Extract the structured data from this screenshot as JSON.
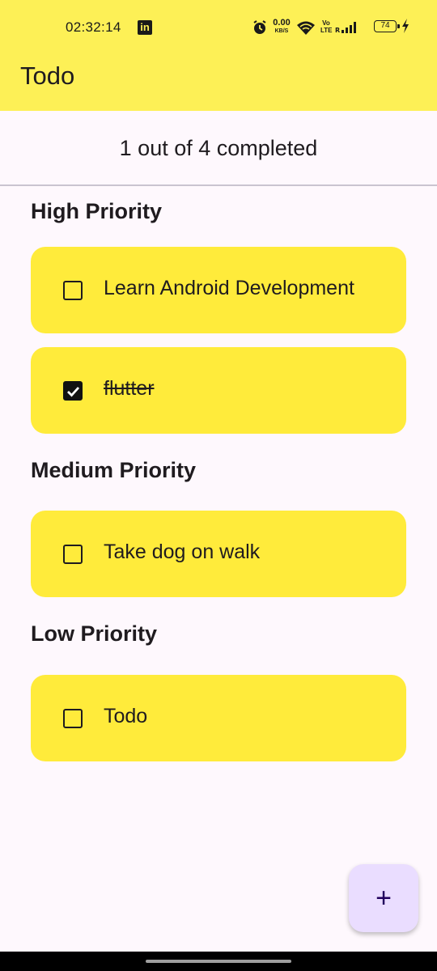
{
  "status_bar": {
    "time": "02:32:14",
    "notification_icon": "linkedin-icon",
    "notification_glyph": "in",
    "net_speed_value": "0.00",
    "net_speed_unit": "KB/S",
    "volte_label": "Vo\nLTE",
    "battery_level": "74",
    "icons": [
      "alarm-icon",
      "wifi-icon",
      "signal-icon",
      "battery-icon",
      "charging-bolt-icon"
    ]
  },
  "app_bar": {
    "title": "Todo",
    "color": "#fdf056"
  },
  "summary": "1 out of 4 completed",
  "sections": [
    {
      "title": "High Priority",
      "items": [
        {
          "text": "Learn Android Development",
          "completed": false
        },
        {
          "text": "flutter",
          "completed": true
        }
      ]
    },
    {
      "title": "Medium Priority",
      "items": [
        {
          "text": "Take dog on walk",
          "completed": false
        }
      ]
    },
    {
      "title": "Low Priority",
      "items": [
        {
          "text": "Todo",
          "completed": false
        }
      ]
    }
  ],
  "fab": {
    "label": "+",
    "icon": "add-icon",
    "color": "#eaddff"
  },
  "colors": {
    "card": "#ffeb3b",
    "background": "#fef8fd",
    "divider": "#cac4d0"
  }
}
